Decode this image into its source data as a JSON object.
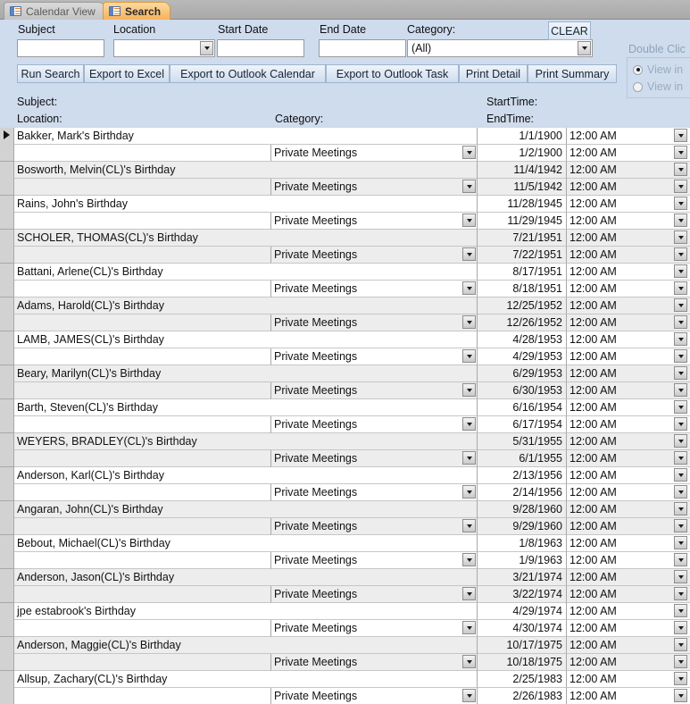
{
  "tabs": [
    {
      "label": "Calendar View",
      "icon": "form-icon",
      "active": false
    },
    {
      "label": "Search",
      "icon": "form-icon",
      "active": true
    }
  ],
  "search_panel": {
    "fields": [
      {
        "name": "subject",
        "label": "Subject",
        "type": "text",
        "value": "",
        "placeholder": ""
      },
      {
        "name": "location",
        "label": "Location",
        "type": "combo",
        "value": "",
        "placeholder": ""
      },
      {
        "name": "start_date",
        "label": "Start Date",
        "type": "text",
        "value": "",
        "placeholder": ""
      },
      {
        "name": "end_date",
        "label": "End Date",
        "type": "text",
        "value": "",
        "placeholder": ""
      },
      {
        "name": "category",
        "label": "Category:",
        "type": "combo",
        "value": "(All)",
        "placeholder": ""
      }
    ],
    "clear_label": "CLEAR",
    "buttons": [
      {
        "name": "run-search",
        "label": "Run Search"
      },
      {
        "name": "export-to-excel",
        "label": "Export to Excel"
      },
      {
        "name": "export-to-outlook-calendar",
        "label": "Export to Outlook Calendar"
      },
      {
        "name": "export-to-outlook-task",
        "label": "Export to Outlook Task"
      },
      {
        "name": "print-detail",
        "label": "Print Detail"
      },
      {
        "name": "print-summary",
        "label": "Print Summary"
      }
    ],
    "double_click_group": {
      "title": "Double Clic",
      "options": [
        {
          "label": "View in",
          "selected": true
        },
        {
          "label": "View in",
          "selected": false
        }
      ]
    }
  },
  "column_captions": {
    "subject": "Subject:",
    "location": "Location:",
    "category": "Category:",
    "start_time": "StartTime:",
    "end_time": "EndTime:"
  },
  "colors": {
    "panel_bg": "#cfdcee",
    "accent_tab": "#f6b25c",
    "band_row": "#ededed",
    "grid_line": "#a8a8a8"
  },
  "grid": {
    "category_value": "Private Meetings",
    "time_value": "12:00 AM",
    "records": [
      {
        "subject": "Bakker, Mark's Birthday",
        "location": "",
        "category": "Private Meetings",
        "start_date": "1/1/1900",
        "start_time": "12:00 AM",
        "end_date": "1/2/1900",
        "end_time": "12:00 AM",
        "selected": true,
        "band": false
      },
      {
        "subject": "Bosworth, Melvin(CL)'s Birthday",
        "location": "",
        "category": "Private Meetings",
        "start_date": "11/4/1942",
        "start_time": "12:00 AM",
        "end_date": "11/5/1942",
        "end_time": "12:00 AM",
        "selected": false,
        "band": true
      },
      {
        "subject": "Rains, John's Birthday",
        "location": "",
        "category": "Private Meetings",
        "start_date": "11/28/1945",
        "start_time": "12:00 AM",
        "end_date": "11/29/1945",
        "end_time": "12:00 AM",
        "selected": false,
        "band": false
      },
      {
        "subject": "SCHOLER, THOMAS(CL)'s Birthday",
        "location": "",
        "category": "Private Meetings",
        "start_date": "7/21/1951",
        "start_time": "12:00 AM",
        "end_date": "7/22/1951",
        "end_time": "12:00 AM",
        "selected": false,
        "band": true
      },
      {
        "subject": "Battani, Arlene(CL)'s Birthday",
        "location": "",
        "category": "Private Meetings",
        "start_date": "8/17/1951",
        "start_time": "12:00 AM",
        "end_date": "8/18/1951",
        "end_time": "12:00 AM",
        "selected": false,
        "band": false
      },
      {
        "subject": "Adams, Harold(CL)'s Birthday",
        "location": "",
        "category": "Private Meetings",
        "start_date": "12/25/1952",
        "start_time": "12:00 AM",
        "end_date": "12/26/1952",
        "end_time": "12:00 AM",
        "selected": false,
        "band": true
      },
      {
        "subject": "LAMB, JAMES(CL)'s Birthday",
        "location": "",
        "category": "Private Meetings",
        "start_date": "4/28/1953",
        "start_time": "12:00 AM",
        "end_date": "4/29/1953",
        "end_time": "12:00 AM",
        "selected": false,
        "band": false
      },
      {
        "subject": "Beary, Marilyn(CL)'s Birthday",
        "location": "",
        "category": "Private Meetings",
        "start_date": "6/29/1953",
        "start_time": "12:00 AM",
        "end_date": "6/30/1953",
        "end_time": "12:00 AM",
        "selected": false,
        "band": true
      },
      {
        "subject": "Barth, Steven(CL)'s Birthday",
        "location": "",
        "category": "Private Meetings",
        "start_date": "6/16/1954",
        "start_time": "12:00 AM",
        "end_date": "6/17/1954",
        "end_time": "12:00 AM",
        "selected": false,
        "band": false
      },
      {
        "subject": "WEYERS, BRADLEY(CL)'s Birthday",
        "location": "",
        "category": "Private Meetings",
        "start_date": "5/31/1955",
        "start_time": "12:00 AM",
        "end_date": "6/1/1955",
        "end_time": "12:00 AM",
        "selected": false,
        "band": true
      },
      {
        "subject": "Anderson, Karl(CL)'s Birthday",
        "location": "",
        "category": "Private Meetings",
        "start_date": "2/13/1956",
        "start_time": "12:00 AM",
        "end_date": "2/14/1956",
        "end_time": "12:00 AM",
        "selected": false,
        "band": false
      },
      {
        "subject": "Angaran, John(CL)'s Birthday",
        "location": "",
        "category": "Private Meetings",
        "start_date": "9/28/1960",
        "start_time": "12:00 AM",
        "end_date": "9/29/1960",
        "end_time": "12:00 AM",
        "selected": false,
        "band": true
      },
      {
        "subject": "Bebout, Michael(CL)'s Birthday",
        "location": "",
        "category": "Private Meetings",
        "start_date": "1/8/1963",
        "start_time": "12:00 AM",
        "end_date": "1/9/1963",
        "end_time": "12:00 AM",
        "selected": false,
        "band": false
      },
      {
        "subject": "Anderson, Jason(CL)'s Birthday",
        "location": "",
        "category": "Private Meetings",
        "start_date": "3/21/1974",
        "start_time": "12:00 AM",
        "end_date": "3/22/1974",
        "end_time": "12:00 AM",
        "selected": false,
        "band": true
      },
      {
        "subject": "jpe estabrook's Birthday",
        "location": "",
        "category": "Private Meetings",
        "start_date": "4/29/1974",
        "start_time": "12:00 AM",
        "end_date": "4/30/1974",
        "end_time": "12:00 AM",
        "selected": false,
        "band": false
      },
      {
        "subject": "Anderson, Maggie(CL)'s Birthday",
        "location": "",
        "category": "Private Meetings",
        "start_date": "10/17/1975",
        "start_time": "12:00 AM",
        "end_date": "10/18/1975",
        "end_time": "12:00 AM",
        "selected": false,
        "band": true
      },
      {
        "subject": "Allsup, Zachary(CL)'s Birthday",
        "location": "",
        "category": "Private Meetings",
        "start_date": "2/25/1983",
        "start_time": "12:00 AM",
        "end_date": "2/26/1983",
        "end_time": "12:00 AM",
        "selected": false,
        "band": false
      }
    ]
  }
}
